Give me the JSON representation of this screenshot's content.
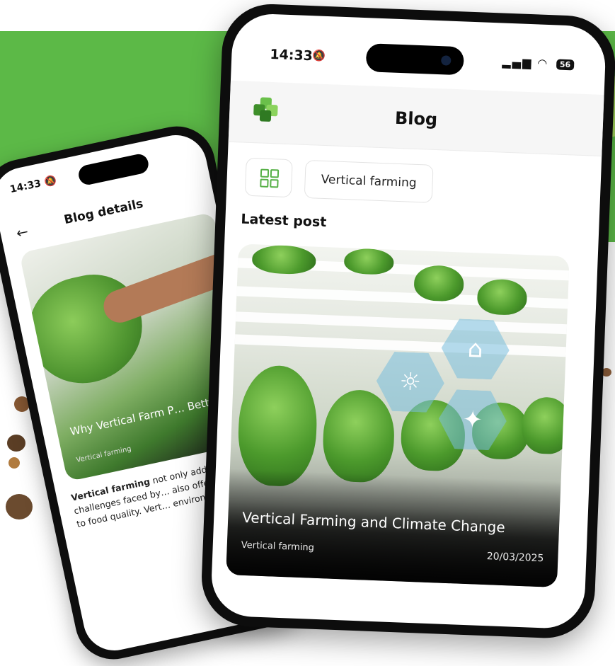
{
  "back_screen": {
    "status_time": "14:33",
    "title": "Blog details",
    "card_title": "Why Vertical Farm P… Better",
    "card_tag": "Vertical farming",
    "body_lead": "Vertical farming",
    "body_rest": " not only addresses challenges faced by… also offers exception… to food quality. Vert… environmentally su…"
  },
  "front_screen": {
    "status_time": "14:33",
    "battery": "56",
    "header_title": "Blog",
    "filter_chip": "Vertical farming",
    "section_title": "Latest post",
    "post": {
      "title": "Vertical Farming and Climate Change",
      "tag": "Vertical farming",
      "date": "20/03/2025"
    }
  },
  "colors": {
    "brand_green": "#5cb947",
    "accent_green": "#56b046"
  },
  "icons": [
    "bell-off-icon",
    "signal-icon",
    "wifi-icon",
    "battery-icon",
    "back-arrow-icon",
    "grid-icon",
    "logo-icon",
    "house-tree-icon",
    "sun-icon",
    "bug-icon"
  ]
}
